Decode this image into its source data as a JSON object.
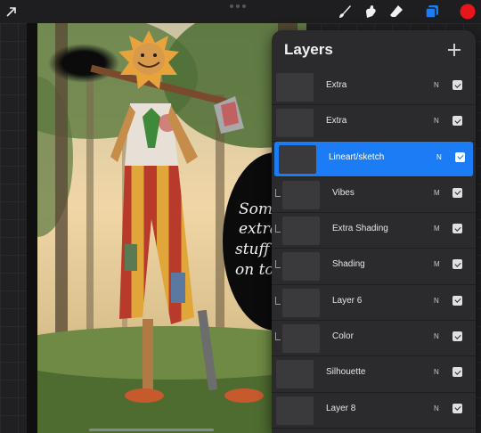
{
  "toolbar": {
    "tools": [
      "brush-icon",
      "smudge-icon",
      "eraser-icon",
      "layers-icon",
      "color-swatch"
    ],
    "accent_color": "#1b7cf5",
    "active_color": "#e8161b"
  },
  "canvas": {
    "annotation_lines": [
      "Some",
      "extra",
      "stuff",
      "on top"
    ]
  },
  "layers_panel": {
    "title": "Layers",
    "layers": [
      {
        "name": "Extra",
        "blend": "N",
        "visible": true,
        "selected": false,
        "clipped": false
      },
      {
        "name": "Extra",
        "blend": "N",
        "visible": true,
        "selected": false,
        "clipped": false
      },
      {
        "name": "Lineart/sketch",
        "blend": "N",
        "visible": true,
        "selected": true,
        "clipped": false
      },
      {
        "name": "Vibes",
        "blend": "M",
        "visible": true,
        "selected": false,
        "clipped": true
      },
      {
        "name": "Extra Shading",
        "blend": "M",
        "visible": true,
        "selected": false,
        "clipped": true
      },
      {
        "name": "Shading",
        "blend": "M",
        "visible": true,
        "selected": false,
        "clipped": true
      },
      {
        "name": "Layer 6",
        "blend": "N",
        "visible": true,
        "selected": false,
        "clipped": true
      },
      {
        "name": "Color",
        "blend": "N",
        "visible": true,
        "selected": false,
        "clipped": true
      },
      {
        "name": "Silhouette",
        "blend": "N",
        "visible": true,
        "selected": false,
        "clipped": false
      },
      {
        "name": "Layer 8",
        "blend": "N",
        "visible": true,
        "selected": false,
        "clipped": false
      }
    ]
  }
}
